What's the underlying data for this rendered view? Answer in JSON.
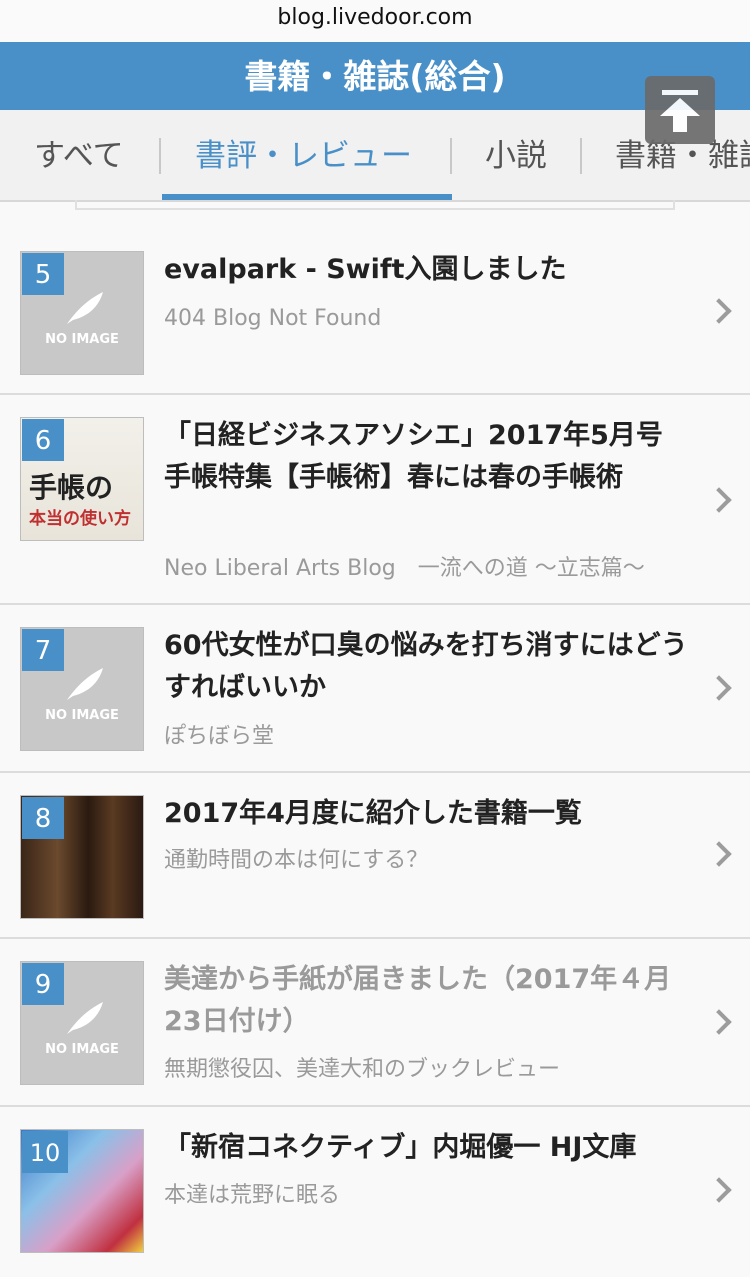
{
  "browser": {
    "url": "blog.livedoor.com"
  },
  "header": {
    "title": "書籍・雑誌(総合)"
  },
  "tabs": [
    {
      "label": "すべて"
    },
    {
      "label": "書評・レビュー"
    },
    {
      "label": "小説"
    },
    {
      "label": "書籍・雑誌"
    }
  ],
  "thumb": {
    "no_image": "NO IMAGE",
    "book_cover_lines": [
      "手帳の",
      "本当の使い方"
    ]
  },
  "items": [
    {
      "rank": "5",
      "title": "evalpark - Swift入園しました",
      "blog": "404 Blog Not Found",
      "has_image": false
    },
    {
      "rank": "6",
      "title": "「日経ビジネスアソシエ」2017年5月号　手帳特集【手帳術】春には春の手帳術",
      "blog": "Neo Liberal Arts Blog　一流への道 〜立志篇〜",
      "has_image": true
    },
    {
      "rank": "7",
      "title": "60代女性が口臭の悩みを打ち消すにはどうすればいいか",
      "blog": "ぽちぼら堂",
      "has_image": false
    },
    {
      "rank": "8",
      "title": "2017年4月度に紹介した書籍一覧",
      "blog": "通勤時間の本は何にする？",
      "has_image": true
    },
    {
      "rank": "9",
      "title": "美達から手紙が届きました（2017年４月23日付け）",
      "blog": "無期懲役囚、美達大和のブックレビュー",
      "has_image": false,
      "visited": true
    },
    {
      "rank": "10",
      "title": "「新宿コネクティブ」内堀優一 HJ文庫",
      "blog": "本達は荒野に眠る",
      "has_image": true
    }
  ]
}
